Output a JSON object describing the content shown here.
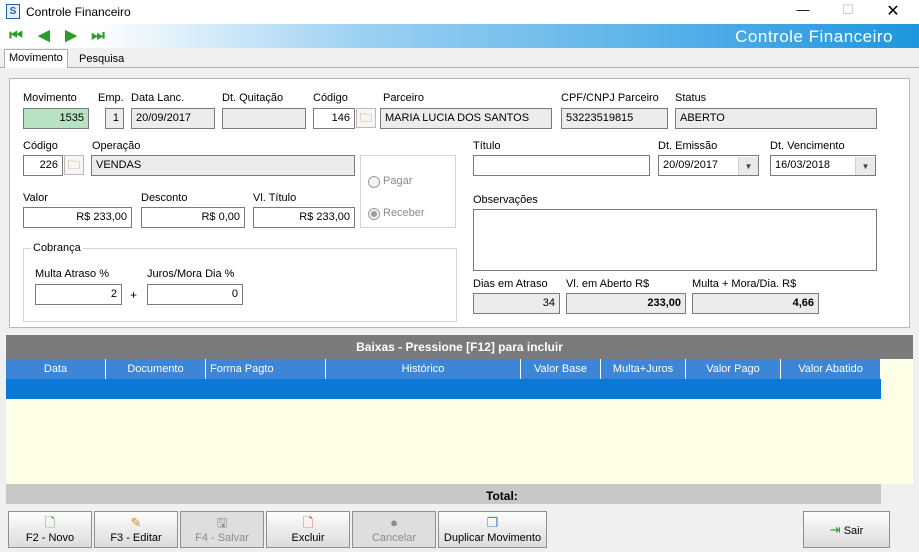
{
  "window": {
    "title": "Controle Financeiro",
    "banner": "Controle Financeiro"
  },
  "tabs": [
    "Movimento",
    "Pesquisa"
  ],
  "fields": {
    "movimento": {
      "label": "Movimento",
      "value": "1535"
    },
    "emp": {
      "label": "Emp.",
      "value": "1"
    },
    "data_lanc": {
      "label": "Data Lanc.",
      "value": "20/09/2017"
    },
    "dt_quitacao": {
      "label": "Dt. Quitação",
      "value": ""
    },
    "codigo_parceiro": {
      "label": "Código",
      "value": "146"
    },
    "parceiro": {
      "label": "Parceiro",
      "value": "MARIA LUCIA DOS SANTOS"
    },
    "cpf_cnpj": {
      "label": "CPF/CNPJ Parceiro",
      "value": "53223519815"
    },
    "status": {
      "label": "Status",
      "value": "ABERTO"
    },
    "codigo_operacao": {
      "label": "Código",
      "value": "226"
    },
    "operacao": {
      "label": "Operação",
      "value": "VENDAS"
    },
    "titulo": {
      "label": "Título",
      "value": ""
    },
    "dt_emissao": {
      "label": "Dt. Emissão",
      "value": "20/09/2017"
    },
    "dt_vencimento": {
      "label": "Dt. Vencimento",
      "value": "16/03/2018"
    },
    "valor": {
      "label": "Valor",
      "value": "R$ 233,00"
    },
    "desconto": {
      "label": "Desconto",
      "value": "R$ 0,00"
    },
    "vl_titulo": {
      "label": "Vl. Título",
      "value": "R$ 233,00"
    },
    "observacoes": {
      "label": "Observações",
      "value": ""
    },
    "dias_atraso": {
      "label": "Dias em Atraso",
      "value": "34"
    },
    "vl_aberto": {
      "label": "Vl. em Aberto R$",
      "value": "233,00"
    },
    "multa_mora": {
      "label": "Multa + Mora/Dia. R$",
      "value": "4,66"
    }
  },
  "tipo": {
    "pagar": "Pagar",
    "receber": "Receber",
    "selected": "Receber"
  },
  "cobranca": {
    "title": "Cobrança",
    "multa_label": "Multa Atraso %",
    "multa_value": "2",
    "plus": "+",
    "juros_label": "Juros/Mora Dia %",
    "juros_value": "0"
  },
  "grid": {
    "header": "Baixas - Pressione [F12] para incluir",
    "columns": [
      "Data",
      "Documento",
      "Forma Pagto",
      "Histórico",
      "Valor Base",
      "Multa+Juros",
      "Valor Pago",
      "Valor Abatido"
    ],
    "total_label": "Total:"
  },
  "buttons": {
    "novo": "F2 - Novo",
    "editar": "F3 - Editar",
    "salvar": "F4 - Salvar",
    "excluir": "Excluir",
    "cancelar": "Cancelar",
    "duplicar": "Duplicar Movimento",
    "sair": "Sair"
  },
  "colors": {
    "accent": "#1e96e0",
    "grid_header": "#3d85d6",
    "selected_row": "#0a78d7",
    "grid_bg": "#fffee6"
  }
}
